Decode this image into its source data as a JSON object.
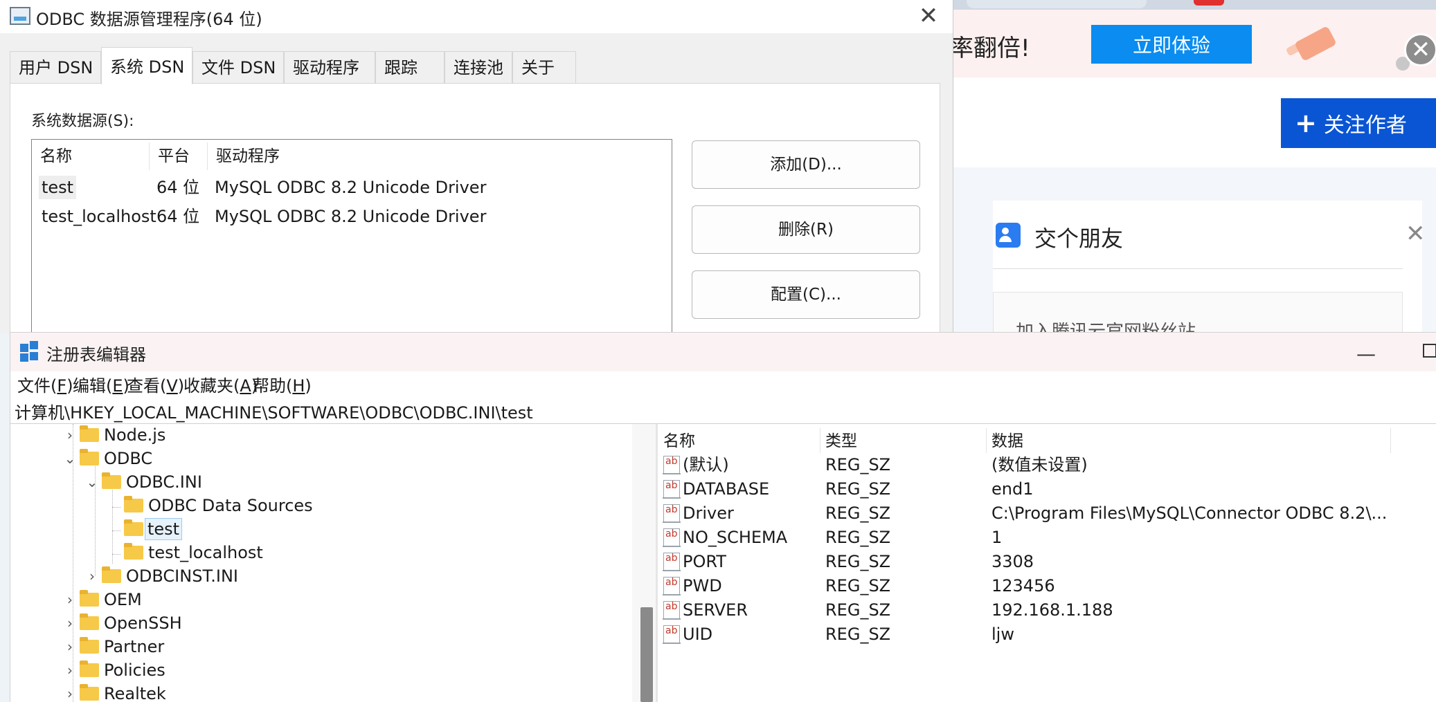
{
  "web": {
    "banner_text": "率翻倍!",
    "try_button": "立即体验",
    "close_button": "✕",
    "follow_button": "关注作者",
    "card_title": "交个朋友",
    "card_close": "✕",
    "card_sub": "加入腾讯云官网粉丝站"
  },
  "odbc": {
    "title": "ODBC 数据源管理程序(64 位)",
    "close": "✕",
    "tabs": [
      "用户 DSN",
      "系统 DSN",
      "文件 DSN",
      "驱动程序",
      "跟踪",
      "连接池",
      "关于"
    ],
    "active_tab": "系统 DSN",
    "list_label": "系统数据源(S):",
    "columns": [
      "名称",
      "平台",
      "驱动程序"
    ],
    "rows": [
      {
        "name": "test",
        "platform": "64 位",
        "driver": "MySQL ODBC 8.2 Unicode Driver"
      },
      {
        "name": "test_localhost",
        "platform": "64 位",
        "driver": "MySQL ODBC 8.2 Unicode Driver"
      }
    ],
    "buttons": {
      "add": "添加(D)...",
      "remove": "删除(R)",
      "configure": "配置(C)..."
    }
  },
  "regedit": {
    "title": "注册表编辑器",
    "minimize": "—",
    "menus": [
      {
        "label": "文件(",
        "key": "F",
        "tail": ")"
      },
      {
        "label": "编辑(",
        "key": "E",
        "tail": ")"
      },
      {
        "label": "查看(",
        "key": "V",
        "tail": ")"
      },
      {
        "label": "收藏夹(",
        "key": "A",
        "tail": ")"
      },
      {
        "label": "帮助(",
        "key": "H",
        "tail": ")"
      }
    ],
    "address": "计算机\\HKEY_LOCAL_MACHINE\\SOFTWARE\\ODBC\\ODBC.INI\\test",
    "tree": [
      {
        "label": "Node.js",
        "level": 0,
        "chevron": "›"
      },
      {
        "label": "ODBC",
        "level": 0,
        "chevron": "⌄"
      },
      {
        "label": "ODBC.INI",
        "level": 1,
        "chevron": "⌄"
      },
      {
        "label": "ODBC Data Sources",
        "level": 2,
        "chevron": ""
      },
      {
        "label": "test",
        "level": 2,
        "chevron": "",
        "selected": true
      },
      {
        "label": "test_localhost",
        "level": 2,
        "chevron": ""
      },
      {
        "label": "ODBCINST.INI",
        "level": 1,
        "chevron": "›"
      },
      {
        "label": "OEM",
        "level": 0,
        "chevron": "›"
      },
      {
        "label": "OpenSSH",
        "level": 0,
        "chevron": "›"
      },
      {
        "label": "Partner",
        "level": 0,
        "chevron": "›"
      },
      {
        "label": "Policies",
        "level": 0,
        "chevron": "›"
      },
      {
        "label": "Realtek",
        "level": 0,
        "chevron": "›"
      }
    ],
    "value_columns": [
      "名称",
      "类型",
      "数据"
    ],
    "values": [
      {
        "name": "(默认)",
        "type": "REG_SZ",
        "data": "(数值未设置)"
      },
      {
        "name": "DATABASE",
        "type": "REG_SZ",
        "data": "end1"
      },
      {
        "name": "Driver",
        "type": "REG_SZ",
        "data": "C:\\Program Files\\MySQL\\Connector ODBC 8.2\\..."
      },
      {
        "name": "NO_SCHEMA",
        "type": "REG_SZ",
        "data": "1"
      },
      {
        "name": "PORT",
        "type": "REG_SZ",
        "data": "3308"
      },
      {
        "name": "PWD",
        "type": "REG_SZ",
        "data": "123456"
      },
      {
        "name": "SERVER",
        "type": "REG_SZ",
        "data": "192.168.1.188"
      },
      {
        "name": "UID",
        "type": "REG_SZ",
        "data": "ljw"
      }
    ],
    "value_icon": "ab"
  }
}
